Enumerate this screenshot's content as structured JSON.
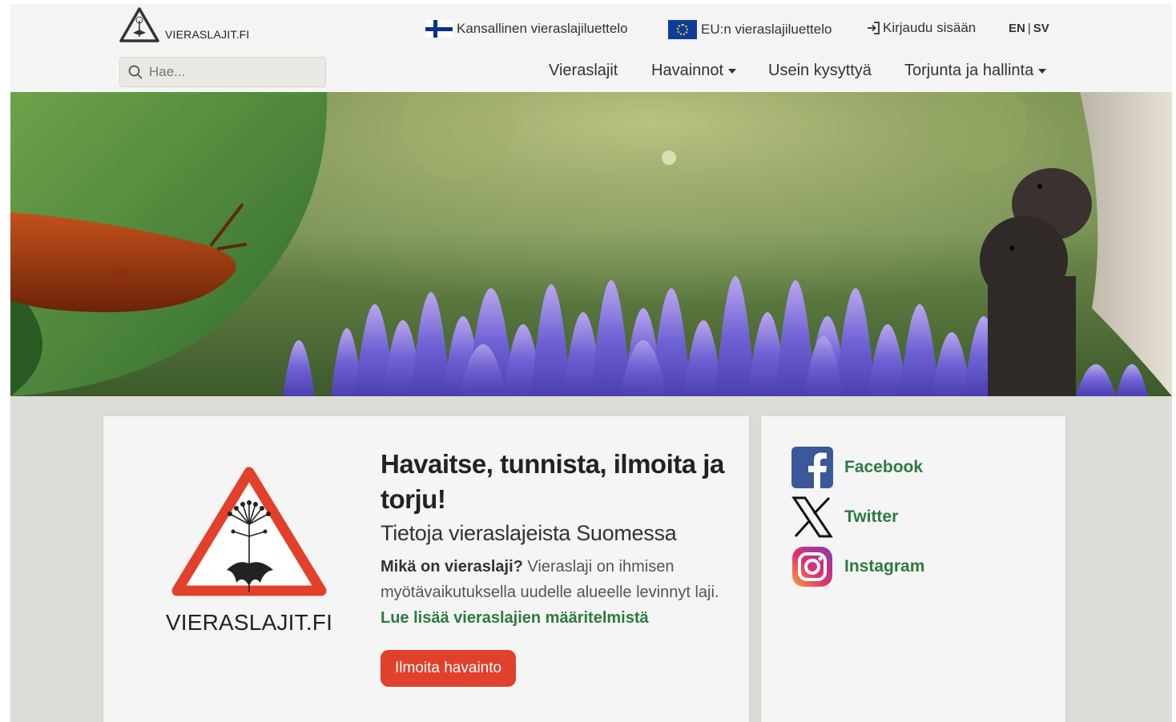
{
  "header": {
    "logo_text": "VIERASLAJIT.FI",
    "top_links": {
      "national_list": "Kansallinen vieraslajiluettelo",
      "eu_list": "EU:n vieraslajiluettelo",
      "login": "Kirjaudu sisään",
      "lang_en": "EN",
      "lang_sep": "|",
      "lang_sv": "SV"
    },
    "search": {
      "placeholder": "Hae..."
    },
    "nav": {
      "species": "Vieraslajit",
      "observations": "Havainnot",
      "faq": "Usein kysyttyä",
      "control": "Torjunta ja hallinta"
    }
  },
  "main": {
    "logo_text": "VIERASLAJIT.FI",
    "headline": "Havaitse, tunnista, ilmoita ja torju!",
    "subheadline": "Tietoja vieraslajeista Suomessa",
    "intro_question": "Mikä on vieraslaji?",
    "intro_text": " Vieraslaji on ihmisen myötävaikutuksella uudelle alueelle levinnyt laji. ",
    "intro_link": "Lue lisää vieraslajien määritelmistä",
    "report_button": "Ilmoita havainto"
  },
  "social": {
    "facebook": "Facebook",
    "twitter": "Twitter",
    "instagram": "Instagram"
  },
  "colors": {
    "accent_green": "#2c7a3e",
    "button_red": "#e1402c",
    "warning_red": "#e2402a",
    "facebook_blue": "#3b5998",
    "page_bg": "#dedcd6"
  }
}
